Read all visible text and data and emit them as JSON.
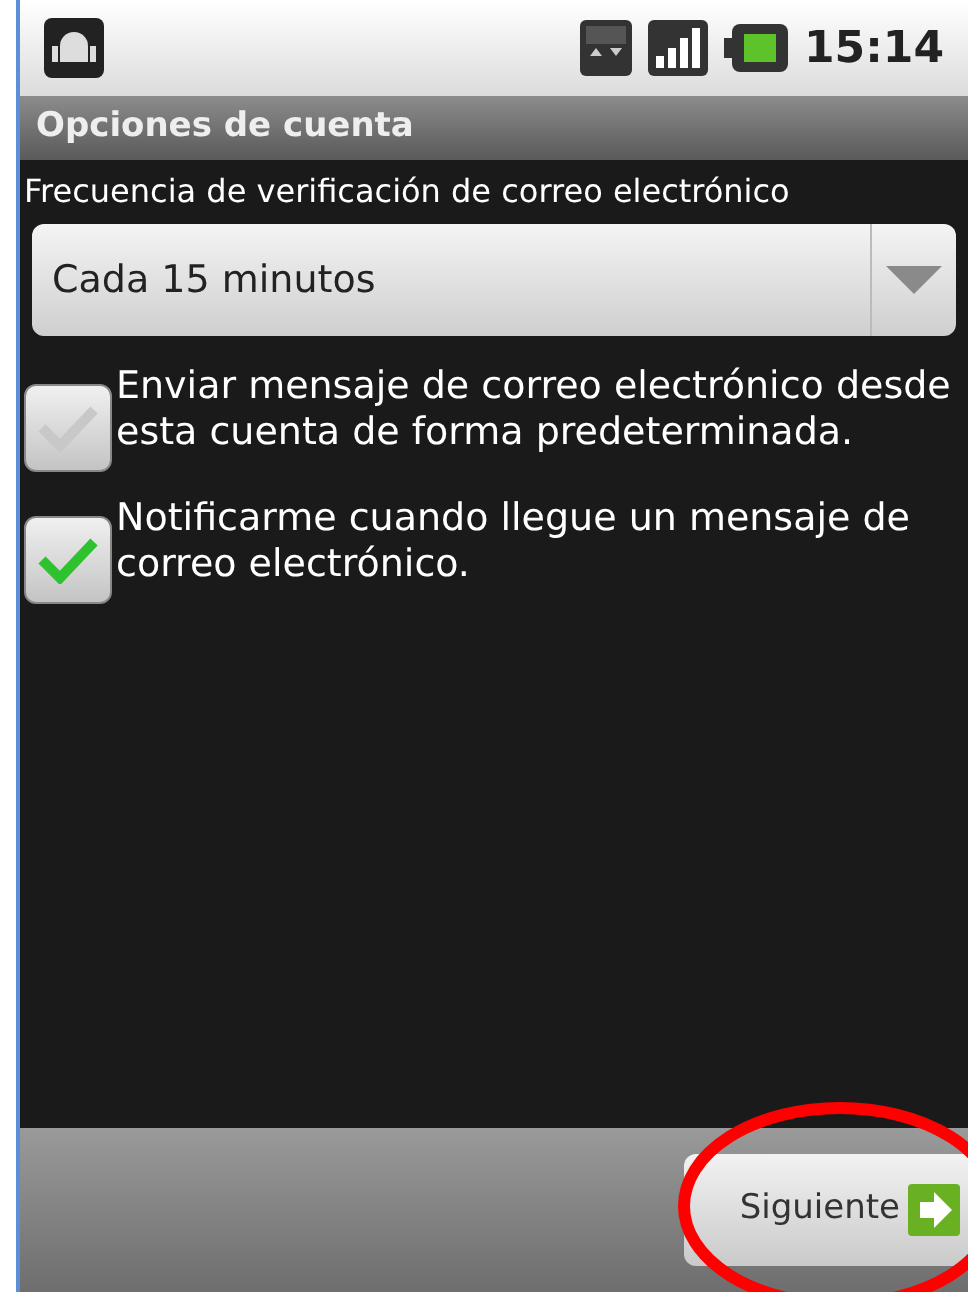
{
  "status_bar": {
    "time": "15:14"
  },
  "title_bar": {
    "title": "Opciones de cuenta"
  },
  "check_frequency": {
    "label": "Frecuencia de verificación de correo electrónico",
    "value": "Cada 15 minutos"
  },
  "options": [
    {
      "label": "Enviar mensaje de correo electrónico desde esta cuenta de forma predeterminada.",
      "checked": false
    },
    {
      "label": "Notificarme cuando llegue un mensaje de correo electrónico.",
      "checked": true
    }
  ],
  "next_button": {
    "label": "Siguiente",
    "highlighted": true
  }
}
